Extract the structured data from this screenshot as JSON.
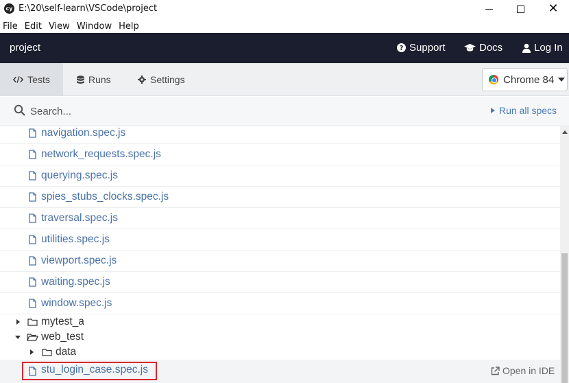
{
  "window": {
    "app_icon": "cy",
    "title": "E:\\20\\self-learn\\VSCode\\project"
  },
  "menu": {
    "items": [
      "File",
      "Edit",
      "View",
      "Window",
      "Help"
    ]
  },
  "header": {
    "project": "project",
    "support": "Support",
    "docs": "Docs",
    "login": "Log In"
  },
  "tabs": {
    "tests": "Tests",
    "runs": "Runs",
    "settings": "Settings",
    "active": "Tests"
  },
  "browser": {
    "label": "Chrome 84"
  },
  "search": {
    "placeholder": "Search...",
    "run_all": "Run all specs"
  },
  "specs": [
    "navigation.spec.js",
    "network_requests.spec.js",
    "querying.spec.js",
    "spies_stubs_clocks.spec.js",
    "traversal.spec.js",
    "utilities.spec.js",
    "viewport.spec.js",
    "waiting.spec.js",
    "window.spec.js"
  ],
  "folders": {
    "mytest_a": "mytest_a",
    "web_test": "web_test",
    "data": "data"
  },
  "selected_spec": {
    "label": "stu_login_case.spec.js",
    "open_ide": "Open in IDE"
  },
  "colors": {
    "header_bg": "#1b1e2e",
    "link": "#4a72a8",
    "highlight": "#d8262e"
  }
}
